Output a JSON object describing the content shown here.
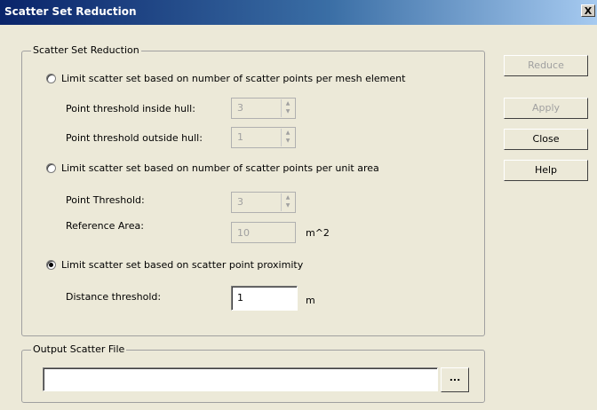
{
  "window": {
    "title": "Scatter Set Reduction",
    "close_label": "X"
  },
  "group_reduction": {
    "label": "Scatter Set Reduction",
    "option_mesh": {
      "label": "Limit scatter set based on number of scatter points per mesh element",
      "checked": false,
      "inside_hull_label": "Point threshold inside hull:",
      "inside_hull_value": "3",
      "outside_hull_label": "Point threshold outside hull:",
      "outside_hull_value": "1"
    },
    "option_area": {
      "label": "Limit scatter set based on number of scatter points per unit area",
      "checked": false,
      "point_threshold_label": "Point Threshold:",
      "point_threshold_value": "3",
      "reference_area_label": "Reference Area:",
      "reference_area_value": "10",
      "reference_area_unit": "m^2"
    },
    "option_proximity": {
      "label": "Limit scatter set based on scatter point proximity",
      "checked": true,
      "distance_label": "Distance threshold:",
      "distance_value": "1",
      "distance_unit": "m"
    }
  },
  "buttons": {
    "reduce": "Reduce",
    "apply": "Apply",
    "close": "Close",
    "help": "Help"
  },
  "group_output": {
    "label": "Output Scatter File",
    "file_value": "",
    "browse_label": "..."
  }
}
